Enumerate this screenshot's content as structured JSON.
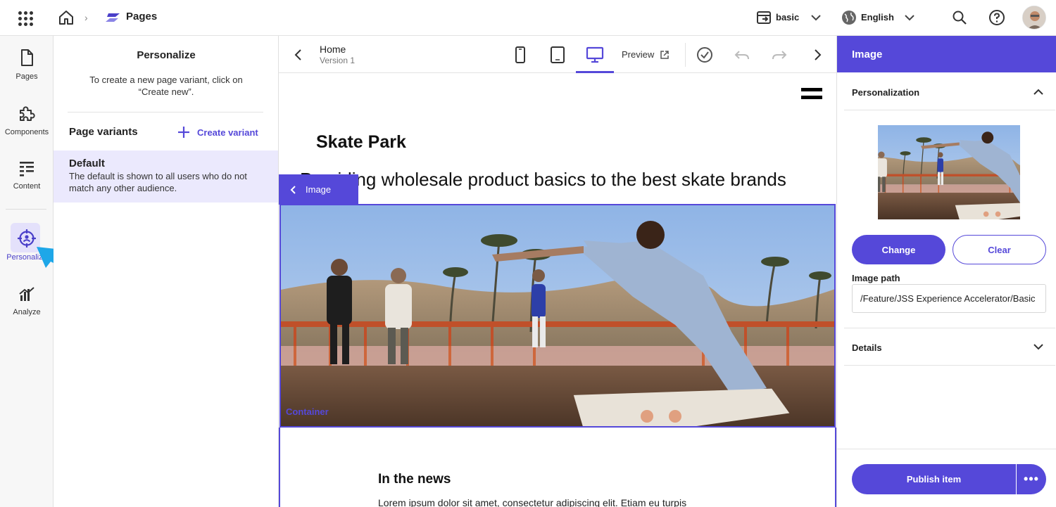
{
  "topbar": {
    "app_name": "Pages",
    "site": "basic",
    "language": "English"
  },
  "rail": {
    "items": [
      {
        "label": "Pages",
        "icon": "page-icon"
      },
      {
        "label": "Components",
        "icon": "puzzle-icon"
      },
      {
        "label": "Content",
        "icon": "content-list-icon"
      },
      {
        "label": "Personalize",
        "icon": "target-icon",
        "active": true
      },
      {
        "label": "Analyze",
        "icon": "analytics-icon"
      }
    ]
  },
  "personalize": {
    "title": "Personalize",
    "description": "To create a new page variant, click on “Create new”.",
    "variants_label": "Page variants",
    "create_variant": "Create variant",
    "default_variant": {
      "name": "Default",
      "description": "The default is shown to all users who do not match any other audience."
    }
  },
  "canvas_toolbar": {
    "page_name": "Home",
    "version": "Version 1",
    "preview": "Preview"
  },
  "canvas": {
    "site_title": "Skate Park",
    "tagline": "Providing wholesale product basics to the best skate brands",
    "selected_chip": "Image",
    "container_label": "Container",
    "news_title": "In the news",
    "lorem": "Lorem ipsum dolor sit amet, consectetur adipiscing elit. Etiam eu turpis"
  },
  "right_panel": {
    "header": "Image",
    "personalization_title": "Personalization",
    "change_button": "Change",
    "clear_button": "Clear",
    "image_path_label": "Image path",
    "image_path_value": "/Feature/JSS Experience Accelerator/Basic",
    "details_title": "Details",
    "publish_button": "Publish item"
  },
  "colors": {
    "accent": "#5548d9",
    "active_bg": "#ebe9fd",
    "arrow": "#1ea7e8"
  }
}
